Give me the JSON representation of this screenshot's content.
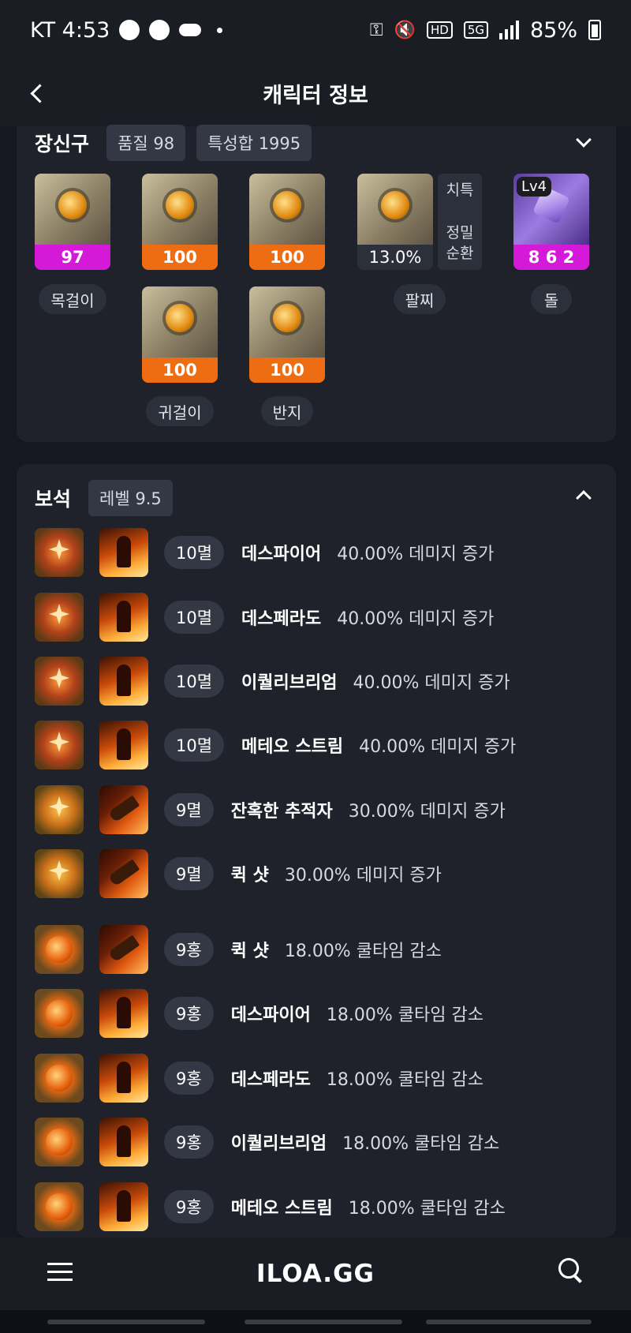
{
  "status_bar": {
    "carrier_time": "KT 4:53",
    "icons": [
      "talk-icon",
      "shield-icon",
      "cloud-icon",
      "key-icon",
      "mute-icon",
      "hd-icon",
      "5g-icon",
      "signal-icon",
      "battery-icon"
    ],
    "hd_label": "HD",
    "net_label": "5G",
    "battery": "85%"
  },
  "app_bar": {
    "title": "캐릭터 정보"
  },
  "equipment": {
    "title": "장신구",
    "quality": "품질 98",
    "stat_sum": "특성합 1995",
    "necklace": {
      "value": "97",
      "label": "목걸이"
    },
    "earrings": {
      "values": [
        "100",
        "100"
      ],
      "label": "귀걸이"
    },
    "rings": {
      "values": [
        "100",
        "100"
      ],
      "label": "반지"
    },
    "bracelet": {
      "value": "13.0%",
      "label": "팔찌",
      "stat1": "치특",
      "stat2": "정밀",
      "stat3": "순환"
    },
    "stone": {
      "level": "Lv4",
      "value": "8 6 2",
      "label": "돌"
    }
  },
  "gems": {
    "title": "보석",
    "level": "레벨 9.5",
    "rows": [
      {
        "lvl": "10멸",
        "skill": "데스파이어",
        "effect": "40.00% 데미지 증가",
        "gem": "gem-r"
      },
      {
        "lvl": "10멸",
        "skill": "데스페라도",
        "effect": "40.00% 데미지 증가",
        "gem": "gem-r"
      },
      {
        "lvl": "10멸",
        "skill": "이퀄리브리엄",
        "effect": "40.00% 데미지 증가",
        "gem": "gem-r"
      },
      {
        "lvl": "10멸",
        "skill": "메테오 스트림",
        "effect": "40.00% 데미지 증가",
        "gem": "gem-r"
      },
      {
        "lvl": "9멸",
        "skill": "잔혹한 추적자",
        "effect": "30.00% 데미지 증가",
        "gem": "gem-y"
      },
      {
        "lvl": "9멸",
        "skill": "퀵 샷",
        "effect": "30.00% 데미지 증가",
        "gem": "gem-y"
      },
      {
        "lvl": "9홍",
        "skill": "퀵 샷",
        "effect": "18.00% 쿨타임 감소",
        "gem": "gem-o"
      },
      {
        "lvl": "9홍",
        "skill": "데스파이어",
        "effect": "18.00% 쿨타임 감소",
        "gem": "gem-o"
      },
      {
        "lvl": "9홍",
        "skill": "데스페라도",
        "effect": "18.00% 쿨타임 감소",
        "gem": "gem-o"
      },
      {
        "lvl": "9홍",
        "skill": "이퀄리브리엄",
        "effect": "18.00% 쿨타임 감소",
        "gem": "gem-o"
      },
      {
        "lvl": "9홍",
        "skill": "메테오 스트림",
        "effect": "18.00% 쿨타임 감소",
        "gem": "gem-o"
      }
    ]
  },
  "bottom_nav": {
    "logo": "ILOA.GG"
  },
  "colors": {
    "background": "#151820",
    "card": "#1f222b",
    "orange_quality": "#ef6d12",
    "magenta_quality": "#d419d9",
    "chip": "#343845"
  }
}
